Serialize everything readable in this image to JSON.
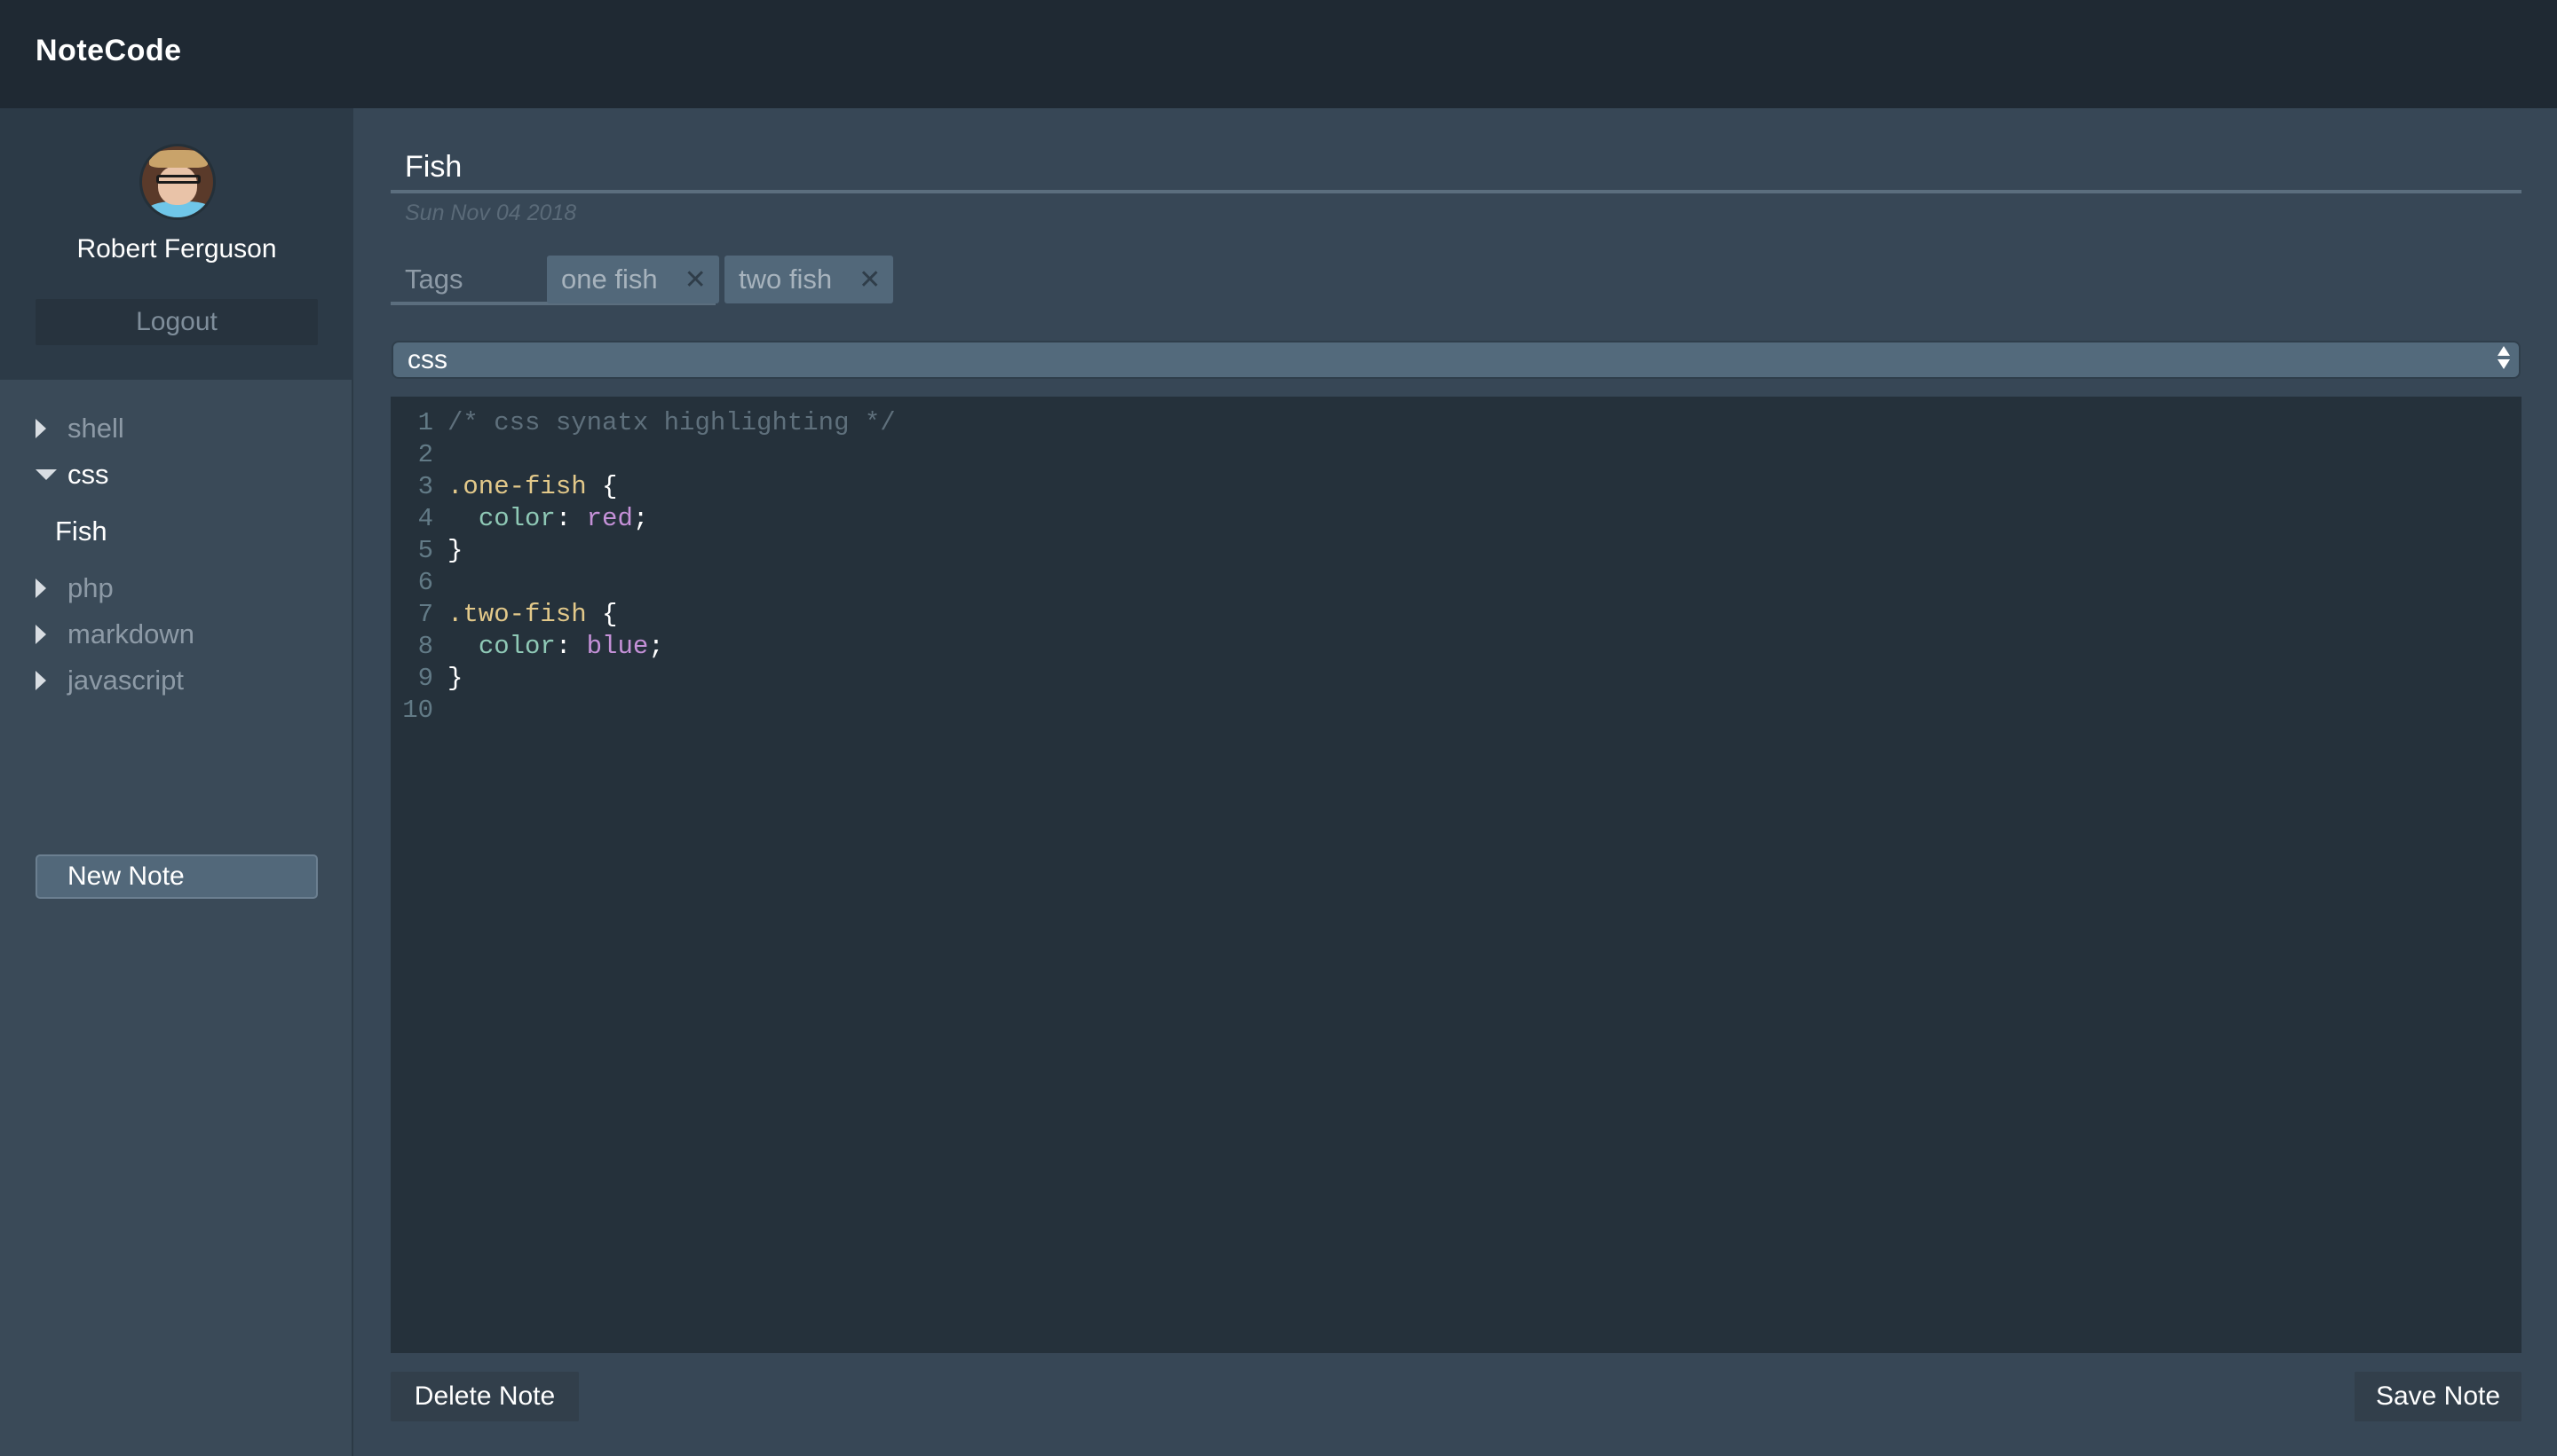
{
  "app": {
    "title": "NoteCode"
  },
  "user": {
    "name": "Robert Ferguson",
    "logout_label": "Logout"
  },
  "sidebar": {
    "categories": [
      {
        "label": "shell",
        "expanded": false,
        "notes": []
      },
      {
        "label": "css",
        "expanded": true,
        "notes": [
          {
            "label": "Fish"
          }
        ]
      },
      {
        "label": "php",
        "expanded": false,
        "notes": []
      },
      {
        "label": "markdown",
        "expanded": false,
        "notes": []
      },
      {
        "label": "javascript",
        "expanded": false,
        "notes": []
      }
    ],
    "new_note_label": "New Note"
  },
  "note": {
    "title": "Fish",
    "date": "Sun Nov 04 2018",
    "tags_placeholder": "Tags",
    "add_tag_icon": "plus-icon",
    "tags": [
      {
        "label": "one fish"
      },
      {
        "label": "two fish"
      }
    ],
    "tag_remove_icon": "close-icon",
    "language": "css"
  },
  "editor": {
    "lines": [
      {
        "n": "1",
        "tokens": [
          {
            "t": "comment",
            "v": "/* css synatx highlighting */"
          }
        ]
      },
      {
        "n": "2",
        "tokens": []
      },
      {
        "n": "3",
        "tokens": [
          {
            "t": "selector",
            "v": ".one-fish"
          },
          {
            "t": "punc",
            "v": " {"
          }
        ]
      },
      {
        "n": "4",
        "tokens": [
          {
            "t": "punc",
            "v": "  "
          },
          {
            "t": "prop",
            "v": "color"
          },
          {
            "t": "punc",
            "v": ": "
          },
          {
            "t": "value",
            "v": "red"
          },
          {
            "t": "punc",
            "v": ";"
          }
        ]
      },
      {
        "n": "5",
        "tokens": [
          {
            "t": "punc",
            "v": "}"
          }
        ]
      },
      {
        "n": "6",
        "tokens": []
      },
      {
        "n": "7",
        "tokens": [
          {
            "t": "selector",
            "v": ".two-fish"
          },
          {
            "t": "punc",
            "v": " {"
          }
        ]
      },
      {
        "n": "8",
        "tokens": [
          {
            "t": "punc",
            "v": "  "
          },
          {
            "t": "prop",
            "v": "color"
          },
          {
            "t": "punc",
            "v": ": "
          },
          {
            "t": "value",
            "v": "blue"
          },
          {
            "t": "punc",
            "v": ";"
          }
        ]
      },
      {
        "n": "9",
        "tokens": [
          {
            "t": "punc",
            "v": "}"
          }
        ]
      },
      {
        "n": "10",
        "tokens": []
      }
    ]
  },
  "actions": {
    "delete_label": "Delete Note",
    "save_label": "Save Note"
  },
  "colors": {
    "header_bg": "#1f2933",
    "sidebar_bg": "#3a4a58",
    "main_bg": "#374756",
    "editor_bg": "#25313b",
    "accent": "#52687a",
    "syntax_comment": "#5f707c",
    "syntax_selector": "#e3c98a",
    "syntax_property": "#8fc9b6",
    "syntax_value": "#c591d8"
  }
}
